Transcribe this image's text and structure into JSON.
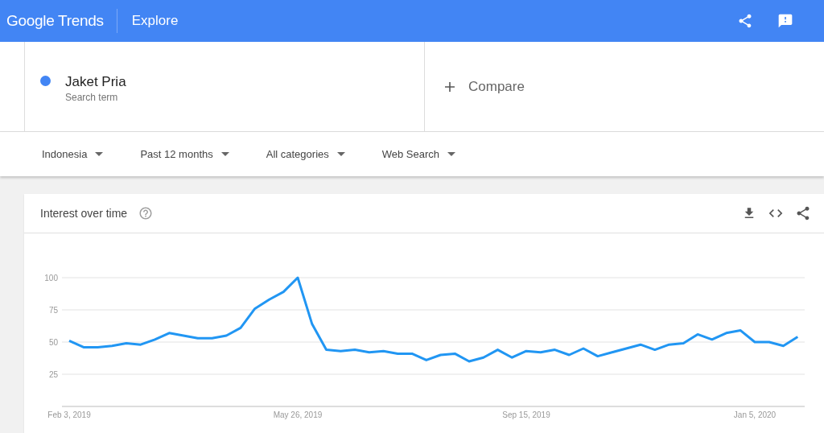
{
  "header": {
    "logo": "Google Trends",
    "title": "Explore"
  },
  "search_term": {
    "name": "Jaket Pria",
    "subtitle": "Search term",
    "color": "#4285f4"
  },
  "compare": {
    "label": "Compare"
  },
  "filters": [
    {
      "label": "Indonesia"
    },
    {
      "label": "Past 12 months"
    },
    {
      "label": "All categories"
    },
    {
      "label": "Web Search"
    }
  ],
  "interest_over_time": {
    "title": "Interest over time",
    "chart_data": {
      "type": "line",
      "categories": [
        "Feb 3, 2019",
        null,
        null,
        null,
        null,
        null,
        null,
        null,
        null,
        null,
        null,
        null,
        null,
        null,
        null,
        null,
        "May 26, 2019",
        null,
        null,
        null,
        null,
        null,
        null,
        null,
        null,
        null,
        null,
        null,
        null,
        null,
        null,
        null,
        "Sep 15, 2019",
        null,
        null,
        null,
        null,
        null,
        null,
        null,
        null,
        null,
        null,
        null,
        null,
        null,
        null,
        null,
        "Jan 5, 2020",
        null,
        null,
        null
      ],
      "series": [
        {
          "color": "#2196f3",
          "values": [
            51,
            46,
            46,
            47,
            49,
            48,
            52,
            57,
            55,
            53,
            53,
            55,
            61,
            76,
            83,
            89,
            100,
            64,
            44,
            43,
            44,
            42,
            43,
            41,
            41,
            36,
            40,
            41,
            35,
            38,
            44,
            38,
            43,
            42,
            44,
            40,
            45,
            39,
            42,
            45,
            48,
            44,
            48,
            49,
            56,
            52,
            57,
            59,
            50,
            50,
            47,
            54
          ]
        }
      ],
      "ylim": [
        0,
        100
      ],
      "grid": true,
      "yticks": [
        25,
        50,
        75,
        100
      ]
    }
  }
}
